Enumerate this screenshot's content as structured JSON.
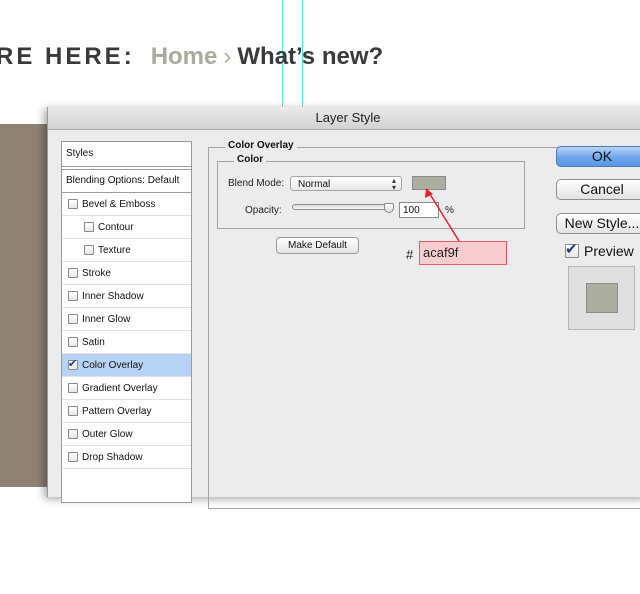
{
  "background": {
    "breadcrumb_prefix": "RE HERE:",
    "breadcrumb_home": "Home",
    "breadcrumb_separator": "›",
    "breadcrumb_current": "What’s new?",
    "guide_color": "#66dddd",
    "side_panel_color": "#8e8172"
  },
  "dialog": {
    "title": "Layer Style",
    "styles_header": "Styles",
    "blending_options": "Blending Options: Default",
    "effects": [
      {
        "label": "Bevel & Emboss",
        "checked": false,
        "indent": false
      },
      {
        "label": "Contour",
        "checked": false,
        "indent": true
      },
      {
        "label": "Texture",
        "checked": false,
        "indent": true
      },
      {
        "label": "Stroke",
        "checked": false,
        "indent": false
      },
      {
        "label": "Inner Shadow",
        "checked": false,
        "indent": false
      },
      {
        "label": "Inner Glow",
        "checked": false,
        "indent": false
      },
      {
        "label": "Satin",
        "checked": false,
        "indent": false
      },
      {
        "label": "Color Overlay",
        "checked": true,
        "indent": false,
        "selected": true
      },
      {
        "label": "Gradient Overlay",
        "checked": false,
        "indent": false
      },
      {
        "label": "Pattern Overlay",
        "checked": false,
        "indent": false
      },
      {
        "label": "Outer Glow",
        "checked": false,
        "indent": false
      },
      {
        "label": "Drop Shadow",
        "checked": false,
        "indent": false
      }
    ],
    "color_overlay": {
      "section_title": "Color Overlay",
      "group_title": "Color",
      "blend_mode_label": "Blend Mode:",
      "blend_mode_value": "Normal",
      "swatch_color": "#acaf9f",
      "opacity_label": "Opacity:",
      "opacity_value": "100",
      "opacity_unit": "%",
      "opacity_level": 1.0,
      "make_default_label": "Make Default"
    },
    "annotation": {
      "hash": "#",
      "hex_value": "acaf9f",
      "arrow_color": "#e8202c"
    },
    "buttons": {
      "ok": "OK",
      "cancel": "Cancel",
      "new_style": "New Style...",
      "preview_label": "Preview",
      "preview_checked": true
    }
  }
}
